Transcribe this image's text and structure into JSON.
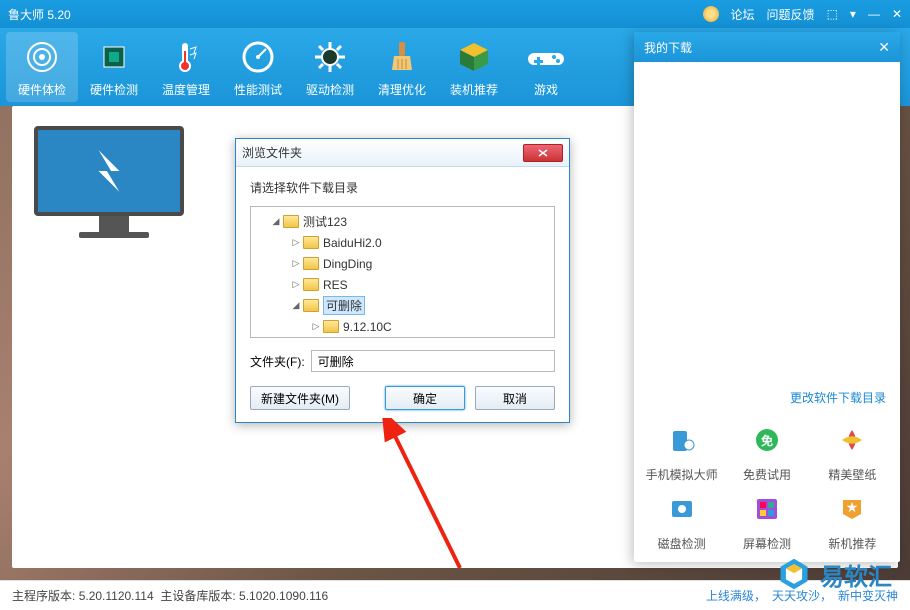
{
  "window": {
    "title": "鲁大师 5.20"
  },
  "titlebar": {
    "forum": "论坛",
    "feedback": "问题反馈"
  },
  "toolbar": [
    {
      "label": "硬件体检",
      "icon": "target"
    },
    {
      "label": "硬件检测",
      "icon": "chip"
    },
    {
      "label": "温度管理",
      "icon": "thermo"
    },
    {
      "label": "性能测试",
      "icon": "gauge"
    },
    {
      "label": "驱动检测",
      "icon": "gear"
    },
    {
      "label": "清理优化",
      "icon": "brush"
    },
    {
      "label": "装机推荐",
      "icon": "box"
    },
    {
      "label": "游戏",
      "icon": "gamepad"
    }
  ],
  "dialog": {
    "title": "浏览文件夹",
    "prompt": "请选择软件下载目录",
    "tree": {
      "root": "测试123",
      "children": [
        "BaiduHi2.0",
        "DingDing",
        "RES"
      ],
      "selected": "可删除",
      "selected_children": [
        "9.12.10C"
      ]
    },
    "folder_label": "文件夹(F):",
    "folder_value": "可删除",
    "btn_new": "新建文件夹(M)",
    "btn_ok": "确定",
    "btn_cancel": "取消"
  },
  "download_panel": {
    "title": "我的下载",
    "change_dir": "更改软件下载目录",
    "grid": [
      {
        "label": "手机模拟大师",
        "color": "#3a9ad8"
      },
      {
        "label": "免费试用",
        "color": "#2fb85a"
      },
      {
        "label": "精美壁纸",
        "color": "#e04a4a"
      },
      {
        "label": "磁盘检测",
        "color": "#3a9ad8"
      },
      {
        "label": "屏幕检测",
        "color": "#a050d8"
      },
      {
        "label": "新机推荐",
        "color": "#f0a030"
      }
    ]
  },
  "footer": {
    "version1_label": "主程序版本:",
    "version1": "5.20.1120.114",
    "version2_label": "主设备库版本:",
    "version2": "5.1020.1090.116",
    "links": [
      "上线满级",
      "天天攻沙",
      "新中变灭神"
    ]
  },
  "watermark": "易软汇"
}
